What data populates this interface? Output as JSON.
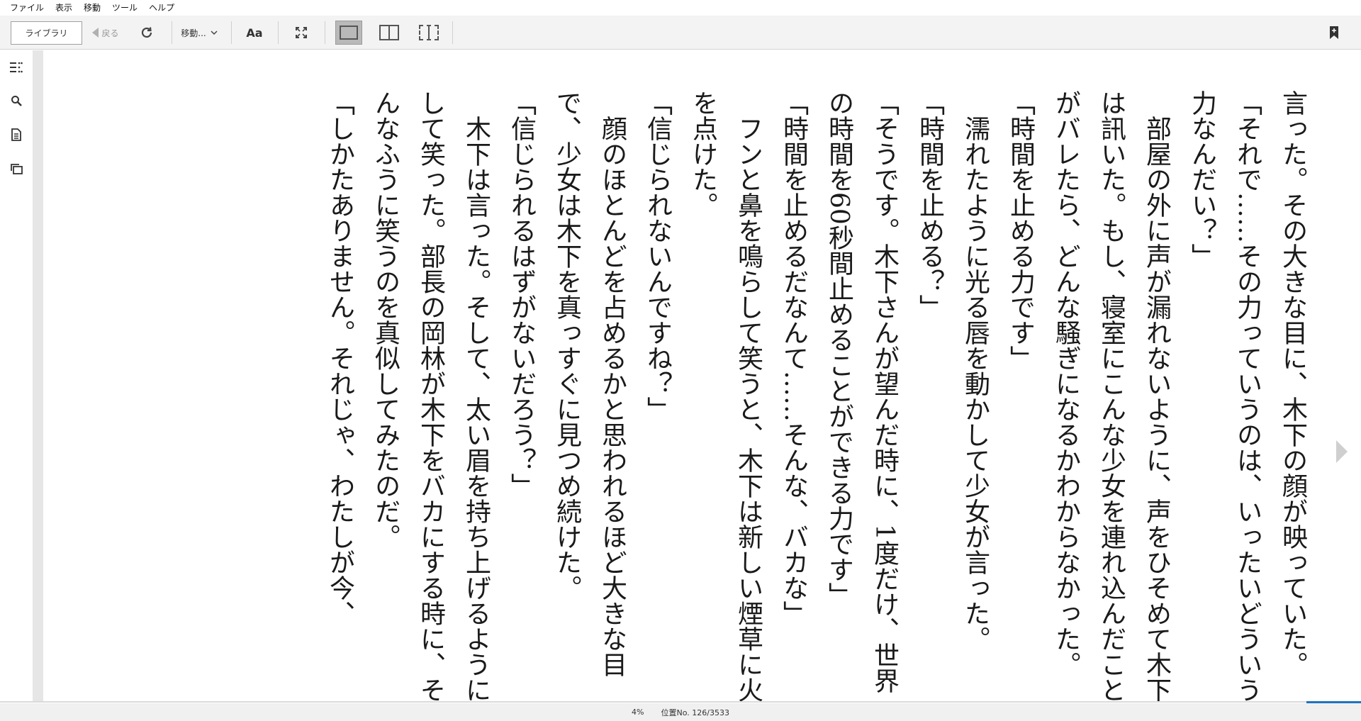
{
  "menu": {
    "items": [
      "ファイル",
      "表示",
      "移動",
      "ツール",
      "ヘルプ"
    ]
  },
  "toolbar": {
    "library_label": "ライブラリ",
    "back_label": "戻る",
    "goto_label": "移動...",
    "font_label": "Aa"
  },
  "reader": {
    "paragraphs": [
      {
        "text": "言った。その大きな目に、木下の顔が映っていた。",
        "indent": false
      },
      {
        "text": "「それで……その力っていうのは、いったいどういう力なんだい？」",
        "indent": false
      },
      {
        "text": "部屋の外に声が漏れないように、声をひそめて木下は訊いた。もし、寝室にこんな少女を連れ込んだことがバレたら、どんな騒ぎになるかわからなかった。",
        "indent": true
      },
      {
        "text": "「時間を止める力です」",
        "indent": false
      },
      {
        "text": "濡れたように光る唇を動かして少女が言った。",
        "indent": true
      },
      {
        "text": "「時間を止める？」",
        "indent": false
      },
      {
        "text": "「そうです。木下さんが望んだ時に、1度だけ、世界の時間を60秒間止めることができる力です」",
        "indent": false
      },
      {
        "text": "「時間を止めるだなんて……そんな、バカな」",
        "indent": false
      },
      {
        "text": "フンと鼻を鳴らして笑うと、木下は新しい煙草に火を点けた。",
        "indent": true
      },
      {
        "text": "「信じられないんですね？」",
        "indent": false
      },
      {
        "text": "顔のほとんどを占めるかと思われるほど大きな目で、少女は木下を真っすぐに見つめ続けた。",
        "indent": true
      },
      {
        "text": "「信じられるはずがないだろう？」",
        "indent": false
      },
      {
        "text": "木下は言った。そして、太い眉を持ち上げるようにして笑った。部長の岡林が木下をバカにする時に、そんなふうに笑うのを真似してみたのだ。",
        "indent": true
      },
      {
        "text": "「しかたありません。それじゃ、わたしが今、",
        "indent": false
      }
    ]
  },
  "status": {
    "percent": "4%",
    "location": "位置No. 126/3533",
    "progress_fraction": 0.04
  },
  "colors": {
    "accent": "#1e73be",
    "toolbar_bg": "#f3f3f3",
    "gutter": "#e6e6e6"
  }
}
